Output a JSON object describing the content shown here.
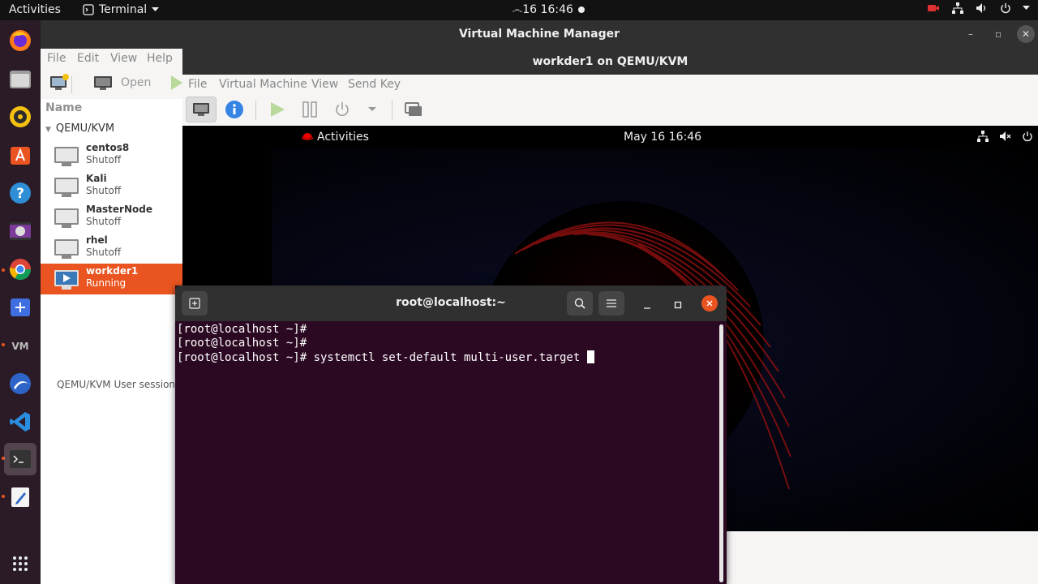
{
  "topbar": {
    "activities": "Activities",
    "app_menu": "Terminal",
    "clock": "෴16  16:46"
  },
  "dock": {
    "items": [
      "firefox-icon",
      "files-icon",
      "rhythmbox-icon",
      "software-icon",
      "help-icon",
      "video-icon",
      "chrome-icon",
      "screenshot-icon",
      "vmware-icon",
      "app-icon",
      "vscode-icon",
      "terminal-icon",
      "text-editor-icon",
      "show-apps-icon"
    ]
  },
  "vmm": {
    "title": "Virtual Machine Manager",
    "menu": [
      "File",
      "Edit",
      "View",
      "Help"
    ],
    "toolbar": {
      "open_label": "Open"
    },
    "list_header": "Name",
    "group": "QEMU/KVM",
    "vms": [
      {
        "name": "centos8",
        "status": "Shutoff"
      },
      {
        "name": "Kali",
        "status": "Shutoff"
      },
      {
        "name": "MasterNode",
        "status": "Shutoff"
      },
      {
        "name": "rhel",
        "status": "Shutoff"
      },
      {
        "name": "workder1",
        "status": "Running"
      }
    ],
    "session": "QEMU/KVM User session - N"
  },
  "vmwin": {
    "title": "workder1 on QEMU/KVM",
    "menu": [
      "File",
      "Virtual Machine",
      "View",
      "Send Key"
    ]
  },
  "guest": {
    "activities": "Activities",
    "datetime": "May 16  16:46"
  },
  "terminal": {
    "title": "root@localhost:~",
    "lines": [
      "[root@localhost ~]#",
      "[root@localhost ~]#",
      "[root@localhost ~]# systemctl set-default multi-user.target "
    ]
  },
  "colors": {
    "accent": "#e95420",
    "terminal_bg": "#2c0922",
    "dock_bg": "#2b1b26"
  }
}
